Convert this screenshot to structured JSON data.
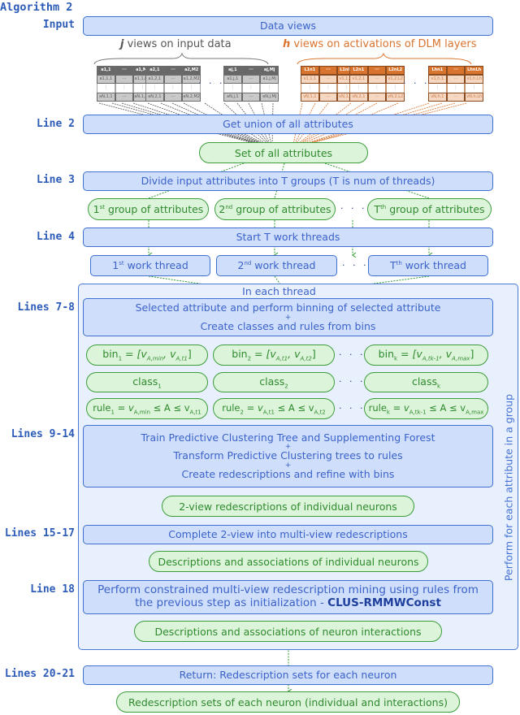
{
  "title": "Algorithm 2",
  "line_labels": {
    "input": "Input",
    "line2": "Line 2",
    "line3": "Line 3",
    "line4": "Line 4",
    "lines7_8": "Lines 7-8",
    "lines9_14": "Lines 9-14",
    "lines15_17": "Lines 15-17",
    "line18": "Line 18",
    "lines20_21": "Lines 20-21"
  },
  "input": {
    "box": "Data views",
    "j_views_var": "j",
    "j_views_text": " views on input data",
    "h_views_var": "h",
    "h_views_text": " views on activations of DLM layers",
    "gray_tables": [
      {
        "h1": "a1,1",
        "h3": "a1,M1",
        "d1": "a1,1,1",
        "d3": "a1,1,M1",
        "l1": "aN,1,1",
        "l3": "aN,1,M1"
      },
      {
        "h1": "a2,1",
        "h3": "a2,M2",
        "d1": "a1,2,1",
        "d3": "a1,2,M2",
        "l1": "aN,2,1",
        "l3": "aN,2,M2"
      },
      {
        "h1": "aj,1",
        "h3": "aj,Mj",
        "d1": "a1,j,1",
        "d3": "a1,j,Mj",
        "l1": "aN,j,1",
        "l3": "aN,j,Mj"
      }
    ],
    "orange_tables": [
      {
        "h1": "L1n1",
        "h3": "L1nL1",
        "d1": "v1,1,1",
        "d3": "v1,1,L1",
        "l1": "vN,1,1",
        "l3": "vN,1,L1"
      },
      {
        "h1": "L2n1",
        "h3": "L2nL2",
        "d1": "v1,2,1",
        "d3": "v1,2,L2",
        "l1": "vN,2,1",
        "l3": "vN,2,L2"
      },
      {
        "h1": "Lhn1",
        "h3": "LhnLh",
        "d1": "v1,h,1",
        "d3": "v1,h,Lh",
        "l1": "vN,h,1",
        "l3": "vN,h,Lh"
      }
    ],
    "ellipsis_h": "· · ·",
    "ellipsis_v": "⋮",
    "dots_cell": "···"
  },
  "steps": {
    "union": "Get union of all attributes",
    "set_all": "Set of all attributes",
    "divide": "Divide input attributes into T groups (T is num of threads)",
    "groups": [
      {
        "pre": "1",
        "sup": "st",
        "post": " group of attributes"
      },
      {
        "pre": "2",
        "sup": "nd",
        "post": " group of attributes"
      },
      {
        "pre": "T",
        "sup": "th",
        "post": " group of attributes"
      }
    ],
    "start_threads": "Start T work threads",
    "threads": [
      {
        "pre": "1",
        "sup": "st",
        "post": " work thread"
      },
      {
        "pre": "2",
        "sup": "nd",
        "post": " work thread"
      },
      {
        "pre": "T",
        "sup": "th",
        "post": " work thread"
      }
    ],
    "in_each_thread": "In each thread",
    "binning_line1": "Selected attribute and perform binning of selected attribute",
    "plus": "+",
    "binning_line2": "Create classes and rules from bins",
    "bins": [
      {
        "name": "bin",
        "idx": "1",
        "expr_a": "[v",
        "sub_a": "A,min",
        "mid": ", v",
        "sub_b": "A,t1",
        "close": "]"
      },
      {
        "name": "bin",
        "idx": "2",
        "expr_a": "[v",
        "sub_a": "A,t1",
        "mid": ", v",
        "sub_b": "A,t2",
        "close": "]"
      },
      {
        "name": "bin",
        "idx": "k",
        "expr_a": "[v",
        "sub_a": "A,tk-1",
        "mid": ", v",
        "sub_b": "A,max",
        "close": "]"
      }
    ],
    "classes": [
      {
        "name": "class",
        "idx": "1"
      },
      {
        "name": "class",
        "idx": "2"
      },
      {
        "name": "class",
        "idx": "k"
      }
    ],
    "rules": [
      {
        "name": "rule",
        "idx": "1",
        "lhs": "v",
        "sub_a": "A,min",
        "mid": " ≤ A ≤ v",
        "sub_b": "A,t1"
      },
      {
        "name": "rule",
        "idx": "2",
        "lhs": "v",
        "sub_a": "A,t1",
        "mid": " ≤ A ≤ v",
        "sub_b": "A,t2"
      },
      {
        "name": "rule",
        "idx": "k",
        "lhs": "v",
        "sub_a": "A,tk-1",
        "mid": " ≤ A ≤ v",
        "sub_b": "A,max"
      }
    ],
    "train_line1": "Train Predictive Clustering Tree and Supplementing Forest",
    "train_line2": "Transform Predictive Clustering trees to rules",
    "train_line3": "Create redescriptions and refine with bins",
    "two_view": "2-view redescriptions of individual neurons",
    "complete": "Complete 2-view into multi-view redescriptions",
    "desc_individual": "Descriptions and associations of individual neurons",
    "constrained_line1": "Perform constrained multi-view redescription mining using rules from",
    "constrained_line2": "the previous step as initialization - ",
    "constrained_bold": "CLUS-RMMWConst",
    "desc_interactions": "Descriptions and associations of neuron interactions",
    "loop_label": "Perform for each attribute in a group",
    "return": "Return: Redescription sets for each neuron",
    "final": "Redescription sets of each neuron (individual and interactions)"
  },
  "colors": {
    "blue_box_fill": "#cfdffb",
    "blue_border": "#3f6fd1",
    "green_fill": "#dcf4d9",
    "green_border": "#3c9c3c",
    "orange": "#d9742f",
    "gray": "#686868",
    "label_blue": "#2c5bb8"
  }
}
